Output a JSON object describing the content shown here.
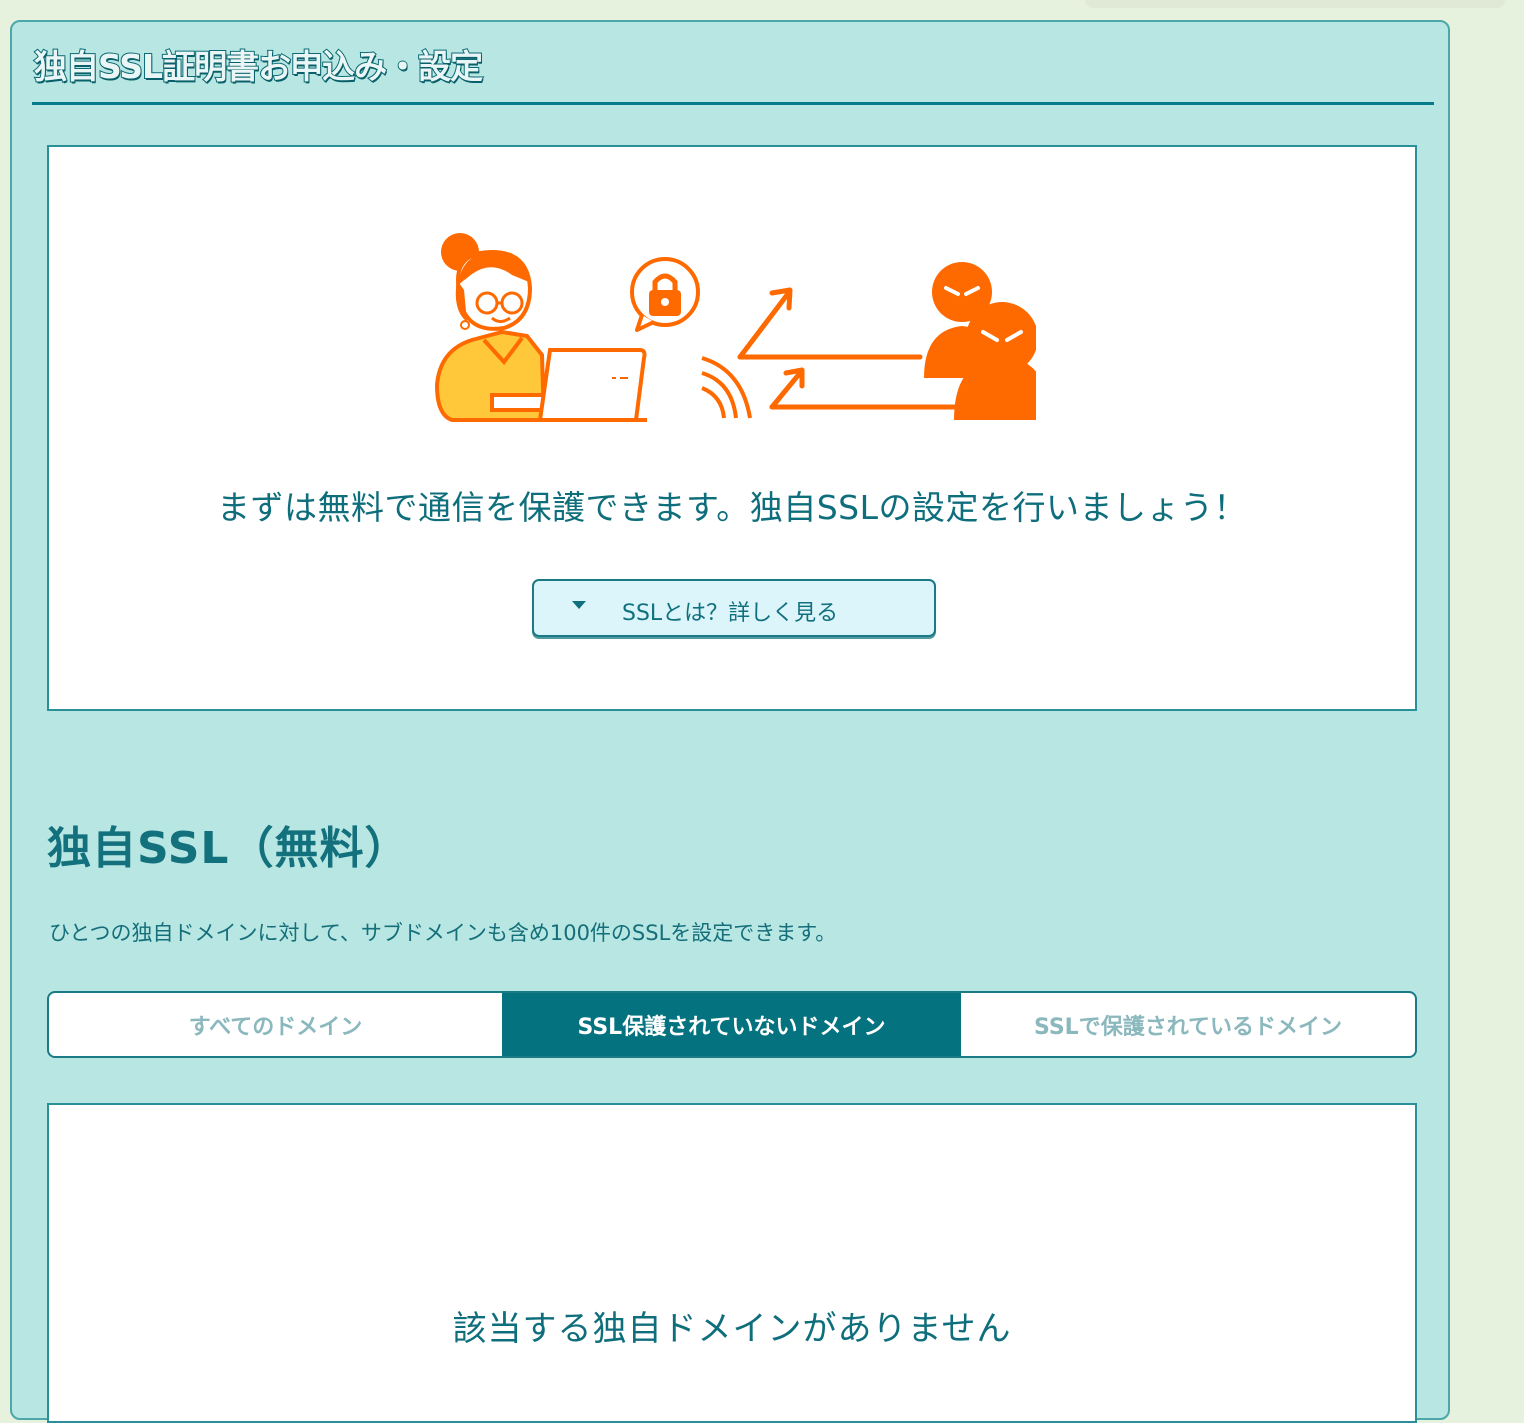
{
  "page": {
    "title": "独自SSL証明書お申込み・設定"
  },
  "hero": {
    "message": "まずは無料で通信を保護できます。独自SSLの設定を行いましょう！",
    "more_button_label": "SSLとは？詳しく見る"
  },
  "section": {
    "heading": "独自SSL（無料）",
    "description": "ひとつの独自ドメインに対して、サブドメインも含め100件のSSLを設定できます。"
  },
  "tabs": [
    {
      "label": "すべてのドメイン",
      "selected": false
    },
    {
      "label": "SSL保護されていないドメイン",
      "selected": true
    },
    {
      "label": "SSLで保護されているドメイン",
      "selected": false
    }
  ],
  "results": {
    "empty_message": "該当する独自ドメインがありません"
  },
  "colors": {
    "panel_bg": "#b8e7e3",
    "accent": "#04727f",
    "illustration_orange": "#ff6a00",
    "illustration_yellow": "#ffc83a"
  },
  "icons": {
    "more_button": "caret-down-icon",
    "illustration_lock": "padlock-icon"
  }
}
